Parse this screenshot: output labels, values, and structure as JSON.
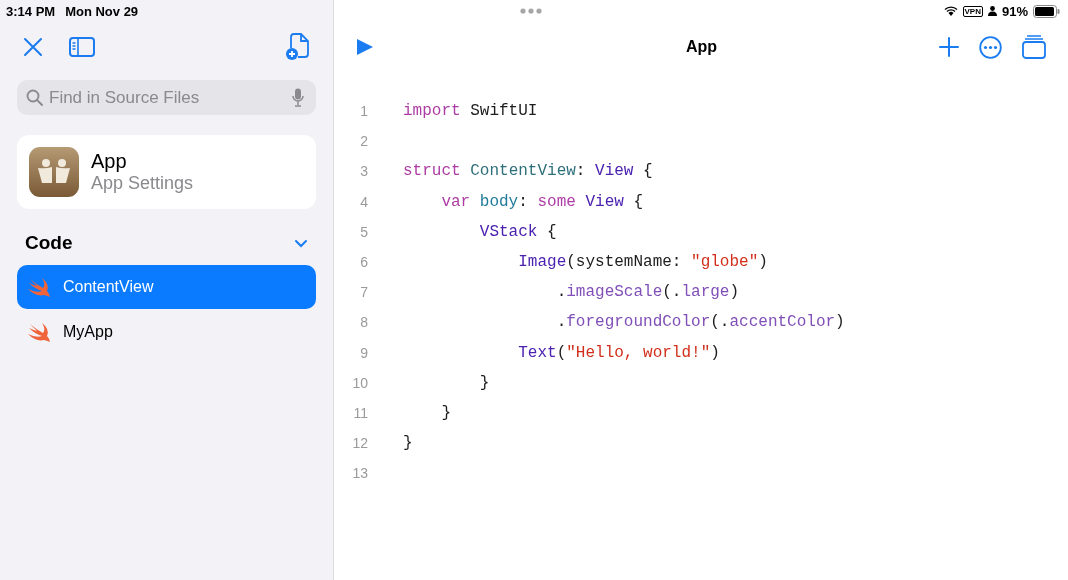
{
  "status_bar": {
    "time": "3:14 PM",
    "date": "Mon Nov 29",
    "vpn": "VPN",
    "battery": "91%"
  },
  "sidebar": {
    "search": {
      "placeholder": "Find in Source Files"
    },
    "project": {
      "name": "App",
      "subtitle": "App Settings"
    },
    "section": {
      "title": "Code",
      "expanded": true
    },
    "files": [
      {
        "name": "ContentView",
        "selected": true
      },
      {
        "name": "MyApp",
        "selected": false
      }
    ]
  },
  "editor": {
    "title": "App",
    "lines": [
      {
        "number": "1",
        "tokens": [
          {
            "text": "import",
            "kind": "keyword"
          },
          {
            "text": " SwiftUI",
            "kind": "plain"
          }
        ]
      },
      {
        "number": "2"
      },
      {
        "number": "3",
        "tokens": [
          {
            "text": "struct ",
            "kind": "keyword"
          },
          {
            "text": "ContentView",
            "kind": "decl"
          },
          {
            "text": ": ",
            "kind": "plain"
          },
          {
            "text": "View",
            "kind": "type"
          },
          {
            "text": " {",
            "kind": "plain"
          }
        ]
      },
      {
        "number": "4",
        "tokens": [
          {
            "text": "    var ",
            "kind": "keyword"
          },
          {
            "text": "body",
            "kind": "property"
          },
          {
            "text": ": ",
            "kind": "plain"
          },
          {
            "text": "some ",
            "kind": "keyword"
          },
          {
            "text": "View",
            "kind": "type"
          },
          {
            "text": " {",
            "kind": "plain"
          }
        ]
      },
      {
        "number": "5",
        "tokens": [
          {
            "text": "        VStack",
            "kind": "type"
          },
          {
            "text": " {",
            "kind": "plain"
          }
        ]
      },
      {
        "number": "6",
        "tokens": [
          {
            "text": "            Image",
            "kind": "type"
          },
          {
            "text": "(systemName: ",
            "kind": "plain"
          },
          {
            "text": "\"globe\"",
            "kind": "string"
          },
          {
            "text": ")",
            "kind": "plain"
          }
        ]
      },
      {
        "number": "7",
        "tokens": [
          {
            "text": "                .",
            "kind": "plain"
          },
          {
            "text": "imageScale",
            "kind": "method"
          },
          {
            "text": "(.",
            "kind": "plain"
          },
          {
            "text": "large",
            "kind": "method"
          },
          {
            "text": ")",
            "kind": "plain"
          }
        ]
      },
      {
        "number": "8",
        "tokens": [
          {
            "text": "                .",
            "kind": "plain"
          },
          {
            "text": "foregroundColor",
            "kind": "method"
          },
          {
            "text": "(.",
            "kind": "plain"
          },
          {
            "text": "accentColor",
            "kind": "method"
          },
          {
            "text": ")",
            "kind": "plain"
          }
        ]
      },
      {
        "number": "9",
        "tokens": [
          {
            "text": "            Text",
            "kind": "type"
          },
          {
            "text": "(",
            "kind": "plain"
          },
          {
            "text": "\"Hello, world!\"",
            "kind": "string"
          },
          {
            "text": ")",
            "kind": "plain"
          }
        ]
      },
      {
        "number": "10",
        "tokens": [
          {
            "text": "        }",
            "kind": "plain"
          }
        ]
      },
      {
        "number": "11",
        "tokens": [
          {
            "text": "    }",
            "kind": "plain"
          }
        ]
      },
      {
        "number": "12",
        "tokens": [
          {
            "text": "}",
            "kind": "plain"
          }
        ]
      },
      {
        "number": "13"
      }
    ]
  }
}
